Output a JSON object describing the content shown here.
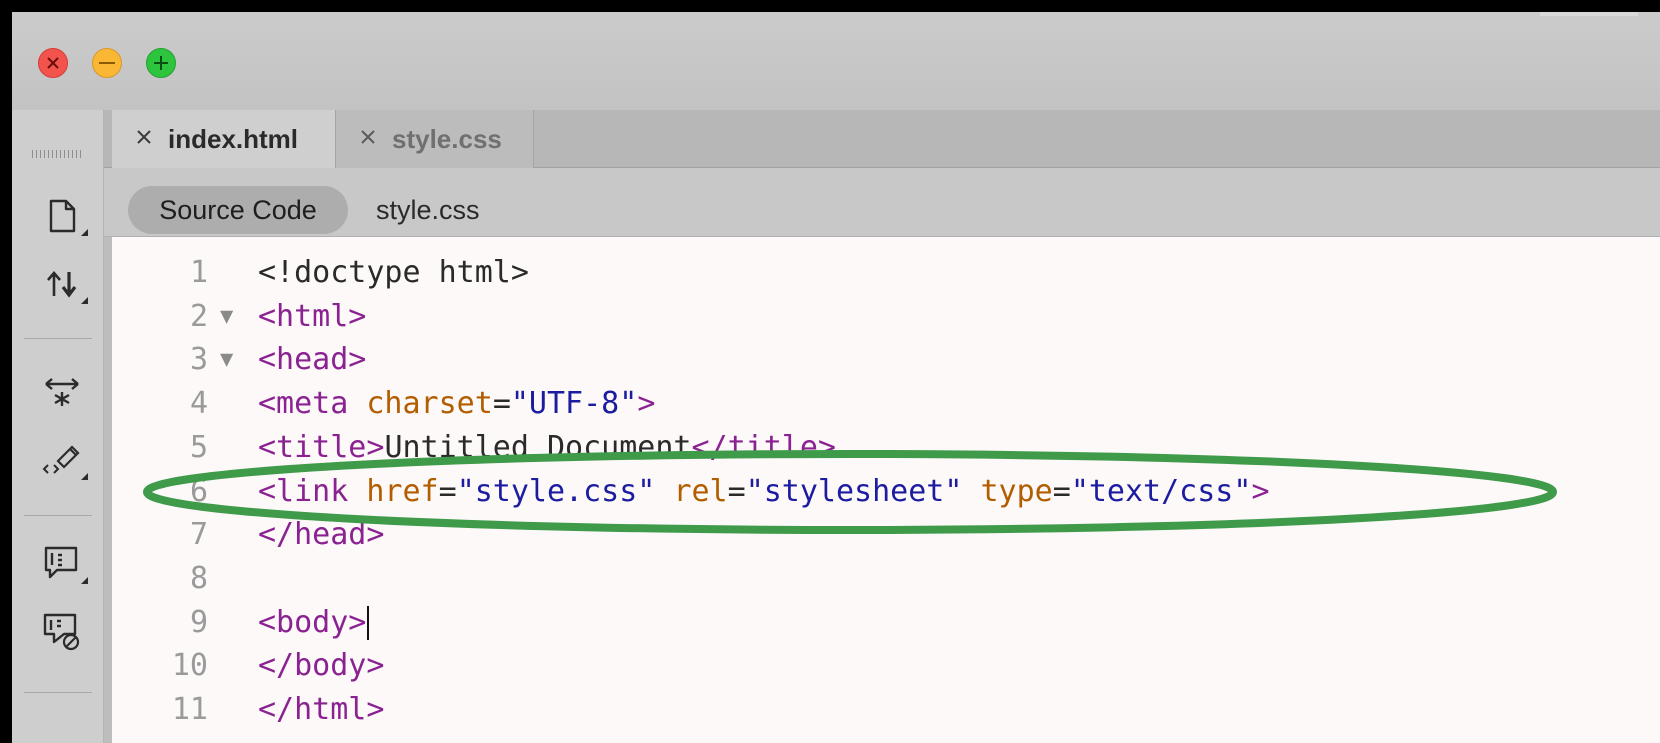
{
  "window": {
    "controls": {
      "close_icon": "close-icon",
      "minimize_icon": "minimize-icon",
      "maximize_icon": "maximize-icon"
    }
  },
  "toolbar": {
    "buttons": [
      {
        "name": "file-icon"
      },
      {
        "name": "get-put-icon"
      },
      {
        "name": "expand-collapse-icon"
      },
      {
        "name": "format-source-icon"
      },
      {
        "name": "apply-comment-icon"
      },
      {
        "name": "remove-comment-icon"
      }
    ]
  },
  "tabs": [
    {
      "label": "index.html",
      "active": true
    },
    {
      "label": "style.css",
      "active": false
    }
  ],
  "related_files": {
    "source_code_label": "Source Code",
    "style_label": "style.css"
  },
  "editor": {
    "lines": [
      {
        "num": "1",
        "fold": "",
        "tokens": [
          {
            "t": "<!doctype html>",
            "k": "plain"
          }
        ]
      },
      {
        "num": "2",
        "fold": "▼",
        "tokens": [
          {
            "t": "<html>",
            "k": "tag"
          }
        ]
      },
      {
        "num": "3",
        "fold": "▼",
        "tokens": [
          {
            "t": "<head>",
            "k": "tag"
          }
        ]
      },
      {
        "num": "4",
        "fold": "",
        "tokens": [
          {
            "t": "<meta ",
            "k": "tag"
          },
          {
            "t": "charset",
            "k": "attr"
          },
          {
            "t": "=",
            "k": "plain"
          },
          {
            "t": "\"UTF-8\"",
            "k": "str"
          },
          {
            "t": ">",
            "k": "tag"
          }
        ]
      },
      {
        "num": "5",
        "fold": "",
        "tokens": [
          {
            "t": "<title>",
            "k": "tag"
          },
          {
            "t": "Untitled Document",
            "k": "plain"
          },
          {
            "t": "</title>",
            "k": "tag"
          }
        ]
      },
      {
        "num": "6",
        "fold": "",
        "tokens": [
          {
            "t": "<link ",
            "k": "tag"
          },
          {
            "t": "href",
            "k": "attr"
          },
          {
            "t": "=",
            "k": "plain"
          },
          {
            "t": "\"style.css\"",
            "k": "str"
          },
          {
            "t": " ",
            "k": "plain"
          },
          {
            "t": "rel",
            "k": "attr"
          },
          {
            "t": "=",
            "k": "plain"
          },
          {
            "t": "\"stylesheet\"",
            "k": "str"
          },
          {
            "t": " ",
            "k": "plain"
          },
          {
            "t": "type",
            "k": "attr"
          },
          {
            "t": "=",
            "k": "plain"
          },
          {
            "t": "\"text/css\"",
            "k": "str"
          },
          {
            "t": ">",
            "k": "tag"
          }
        ]
      },
      {
        "num": "7",
        "fold": "",
        "tokens": [
          {
            "t": "</head>",
            "k": "tag"
          }
        ]
      },
      {
        "num": "8",
        "fold": "",
        "tokens": []
      },
      {
        "num": "9",
        "fold": "",
        "tokens": [
          {
            "t": "<body>",
            "k": "tag"
          }
        ],
        "caret": true
      },
      {
        "num": "10",
        "fold": "",
        "tokens": [
          {
            "t": "</body>",
            "k": "tag"
          }
        ]
      },
      {
        "num": "11",
        "fold": "",
        "tokens": [
          {
            "t": "</html>",
            "k": "tag"
          }
        ]
      }
    ]
  },
  "annotation": {
    "highlight_color": "#3f9a4a"
  }
}
